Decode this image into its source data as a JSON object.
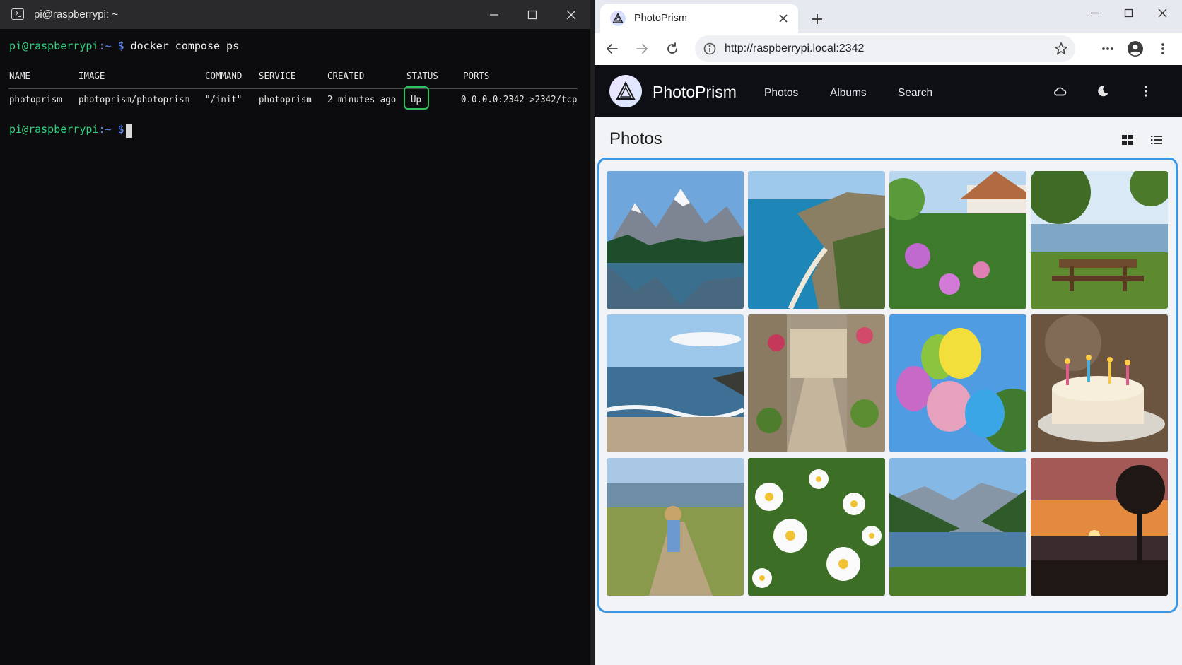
{
  "terminal": {
    "window_title": "pi@raspberrypi: ~",
    "prompt_user": "pi@raspberrypi",
    "prompt_path": ":~",
    "prompt_symbol": "$",
    "command": "docker compose ps",
    "headers": [
      "NAME",
      "IMAGE",
      "COMMAND",
      "SERVICE",
      "CREATED",
      "STATUS",
      "PORTS"
    ],
    "row": [
      "photoprism",
      "photoprism/photoprism",
      "\"/init\"",
      "photoprism",
      "2 minutes ago",
      "Up",
      "0.0.0.0:2342->2342/tcp"
    ],
    "colors": {
      "user": "#35d07f",
      "path": "#5f8bff",
      "status_highlight": "#2fc35f"
    }
  },
  "browser": {
    "tab_title": "PhotoPrism",
    "url": "http://raspberrypi.local:2342",
    "app": {
      "brand": "PhotoPrism",
      "nav": [
        "Photos",
        "Albums",
        "Search"
      ],
      "page_title": "Photos",
      "icons": [
        "cloud-icon",
        "moon-icon",
        "more-vertical-icon",
        "grid-view-icon",
        "list-view-icon"
      ],
      "accent_color": "#3a97e6"
    },
    "photos": [
      "mountain-lake",
      "coastal-cliffs",
      "cottage-garden",
      "picnic-table-lake",
      "beach-waves",
      "flower-alley",
      "balloons",
      "birthday-cake",
      "child-meadow-path",
      "daisies",
      "valley-river",
      "sunset-tree"
    ]
  }
}
